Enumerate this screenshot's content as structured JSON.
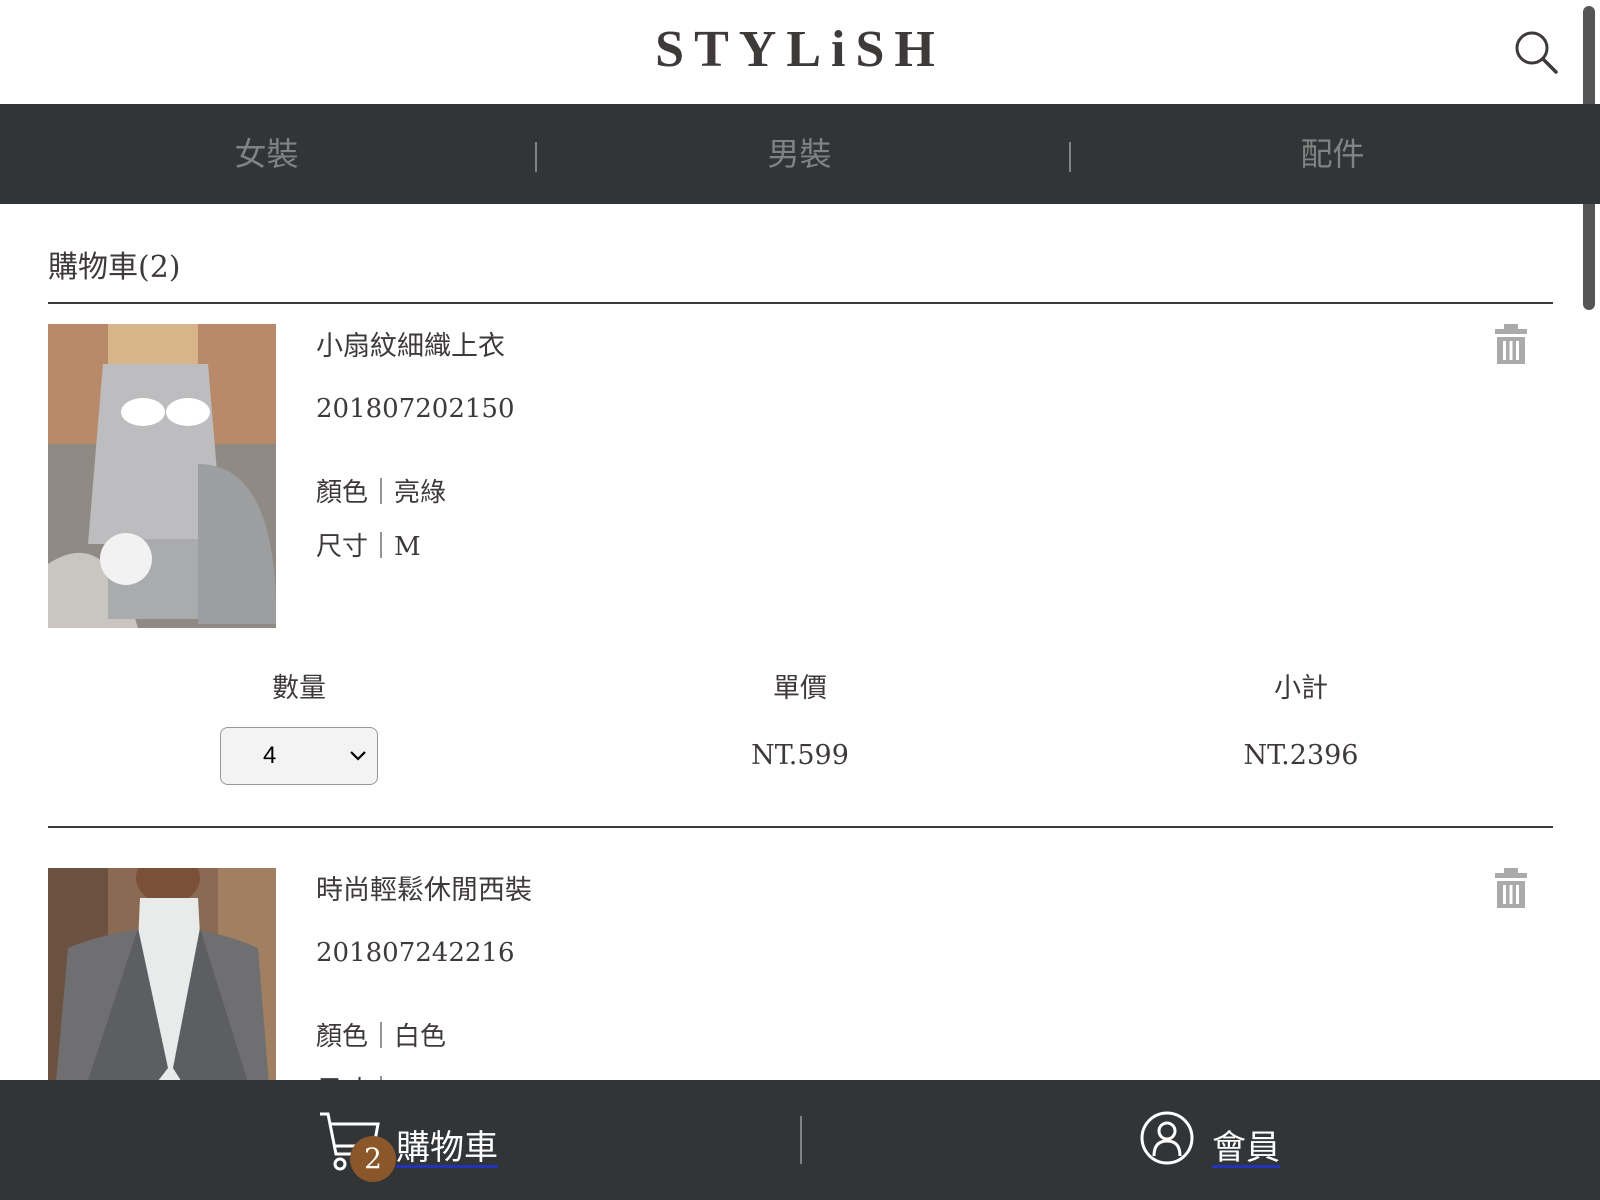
{
  "header": {
    "logo": "STYLiSH",
    "search_icon": "search-icon"
  },
  "categories": [
    "女裝",
    "男裝",
    "配件"
  ],
  "cart": {
    "title": "購物車(2)",
    "column_headers": {
      "quantity": "數量",
      "unit_price": "單價",
      "subtotal": "小計"
    },
    "items": [
      {
        "name": "小扇紋細織上衣",
        "id": "201807202150",
        "color": "顏色｜亮綠",
        "size": "尺寸｜M",
        "quantity": "4",
        "unit_price": "NT.599",
        "subtotal": "NT.2396"
      },
      {
        "name": "時尚輕鬆休閒西裝",
        "id": "201807242216",
        "color": "顏色｜白色",
        "size": "尺寸｜L"
      }
    ]
  },
  "bottom_nav": {
    "cart_label": "購物車",
    "cart_count": "2",
    "member_label": "會員"
  },
  "colors": {
    "bar": "#313538",
    "badge": "#8b572a",
    "text": "#3f3a3a"
  }
}
